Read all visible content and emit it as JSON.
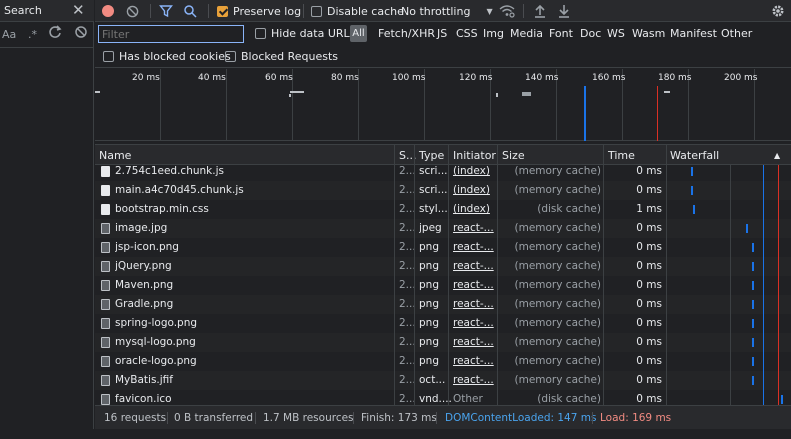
{
  "search": {
    "title": "Search",
    "aa": "Aa",
    "regex": ".*"
  },
  "toolbar": {
    "preserve_log": "Preserve log",
    "disable_cache": "Disable cache",
    "throttling": "No throttling"
  },
  "filter": {
    "placeholder": "Filter",
    "hide_data_urls": "Hide data URLs",
    "all": "All",
    "types": [
      "Fetch/XHR",
      "JS",
      "CSS",
      "Img",
      "Media",
      "Font",
      "Doc",
      "WS",
      "Wasm",
      "Manifest",
      "Other"
    ],
    "has_blocked_cookies": "Has blocked cookies",
    "blocked_requests": "Blocked Requests"
  },
  "overview": {
    "ticks": [
      "20 ms",
      "40 ms",
      "60 ms",
      "80 ms",
      "100 ms",
      "120 ms",
      "140 ms",
      "160 ms",
      "180 ms",
      "200 ms"
    ]
  },
  "columns": {
    "name": "Name",
    "status": "S...",
    "type": "Type",
    "initiator": "Initiator",
    "size": "Size",
    "time": "Time",
    "waterfall": "Waterfall"
  },
  "rows": [
    {
      "name": "2.754c1eed.chunk.js",
      "status": "2...",
      "type": "scri...",
      "initiator": "(index)",
      "size": "(memory cache)",
      "time": "0 ms",
      "icon": "file-icon",
      "wf": 0.2
    },
    {
      "name": "main.a4c70d45.chunk.js",
      "status": "2...",
      "type": "scri...",
      "initiator": "(index)",
      "size": "(memory cache)",
      "time": "0 ms",
      "icon": "file-icon",
      "wf": 0.2
    },
    {
      "name": "bootstrap.min.css",
      "status": "2...",
      "type": "styl...",
      "initiator": "(index)",
      "size": "(disk cache)",
      "time": "1 ms",
      "icon": "file-icon",
      "wf": 0.22
    },
    {
      "name": "image.jpg",
      "status": "2...",
      "type": "jpeg",
      "initiator": "react-...",
      "size": "(memory cache)",
      "time": "0 ms",
      "icon": "image-icon",
      "wf": 0.66
    },
    {
      "name": "jsp-icon.png",
      "status": "2...",
      "type": "png",
      "initiator": "react-...",
      "size": "(memory cache)",
      "time": "0 ms",
      "icon": "image-icon",
      "wf": 0.71
    },
    {
      "name": "jQuery.png",
      "status": "2...",
      "type": "png",
      "initiator": "react-...",
      "size": "(memory cache)",
      "time": "0 ms",
      "icon": "image-icon",
      "wf": 0.71
    },
    {
      "name": "Maven.png",
      "status": "2...",
      "type": "png",
      "initiator": "react-...",
      "size": "(memory cache)",
      "time": "0 ms",
      "icon": "image-icon",
      "wf": 0.71
    },
    {
      "name": "Gradle.png",
      "status": "2...",
      "type": "png",
      "initiator": "react-...",
      "size": "(memory cache)",
      "time": "0 ms",
      "icon": "image-icon",
      "wf": 0.71
    },
    {
      "name": "spring-logo.png",
      "status": "2...",
      "type": "png",
      "initiator": "react-...",
      "size": "(memory cache)",
      "time": "0 ms",
      "icon": "image-icon",
      "wf": 0.71
    },
    {
      "name": "mysql-logo.png",
      "status": "2...",
      "type": "png",
      "initiator": "react-...",
      "size": "(memory cache)",
      "time": "0 ms",
      "icon": "image-icon",
      "wf": 0.71
    },
    {
      "name": "oracle-logo.png",
      "status": "2...",
      "type": "png",
      "initiator": "react-...",
      "size": "(memory cache)",
      "time": "0 ms",
      "icon": "image-icon",
      "wf": 0.71
    },
    {
      "name": "MyBatis.jfif",
      "status": "2...",
      "type": "oct...",
      "initiator": "react-...",
      "size": "(memory cache)",
      "time": "0 ms",
      "icon": "image-icon",
      "wf": 0.71
    },
    {
      "name": "favicon.ico",
      "status": "2...",
      "type": "vnd....",
      "initiator": "Other",
      "size": "(disk cache)",
      "time": "0 ms",
      "icon": "image-icon",
      "wf": 0.95
    }
  ],
  "status": {
    "requests": "16 requests",
    "transferred": "0 B transferred",
    "resources": "1.7 MB resources",
    "finish": "Finish: 173 ms",
    "dom_content_loaded": "DOMContentLoaded: 147 ms",
    "load": "Load: 169 ms"
  },
  "colors": {
    "dcl": "#4aa4ee",
    "load": "#f28b82",
    "accent": "#e8a13a"
  }
}
